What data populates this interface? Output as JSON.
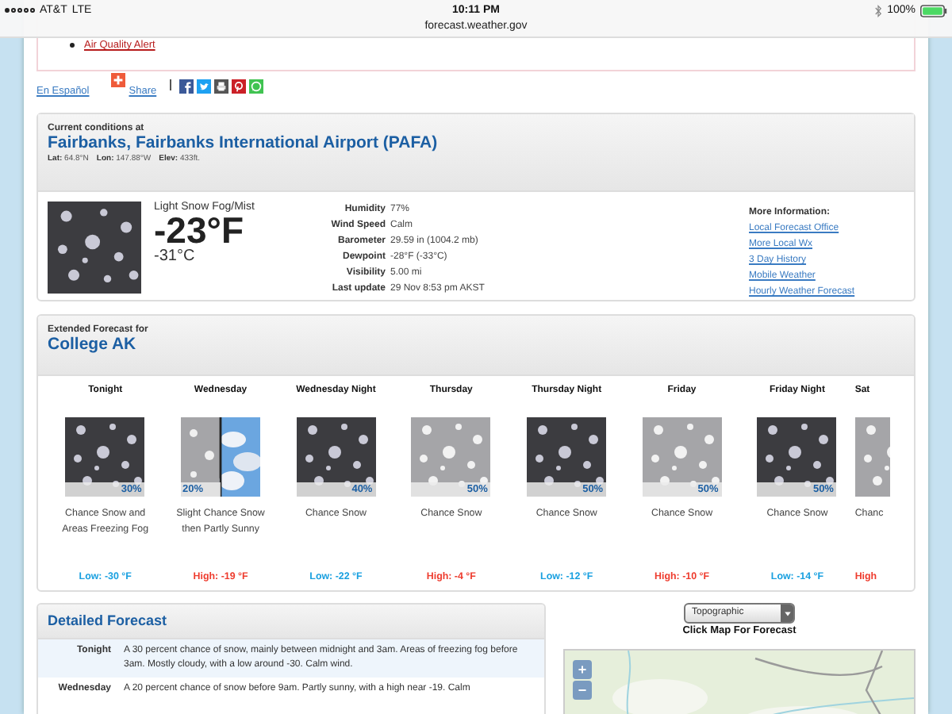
{
  "status_bar": {
    "carrier": "AT&T",
    "network": "LTE",
    "time": "10:11 PM",
    "url": "forecast.weather.gov",
    "battery": "100%"
  },
  "hazards": {
    "items": [
      "Air Quality Alert"
    ]
  },
  "share": {
    "language_link": "En Español",
    "share_label": "Share"
  },
  "current": {
    "heading": "Current conditions at",
    "station": "Fairbanks, Fairbanks International Airport (PAFA)",
    "coords": [
      {
        "label": "Lat:",
        "value": "64.8°N"
      },
      {
        "label": "Lon:",
        "value": "147.88°W"
      },
      {
        "label": "Elev:",
        "value": "433ft."
      }
    ],
    "condition": "Light Snow Fog/Mist",
    "temp_f": "-23°F",
    "temp_c": "-31°C",
    "details": [
      {
        "label": "Humidity",
        "value": "77%"
      },
      {
        "label": "Wind Speed",
        "value": "Calm"
      },
      {
        "label": "Barometer",
        "value": "29.59 in (1004.2 mb)"
      },
      {
        "label": "Dewpoint",
        "value": "-28°F (-33°C)"
      },
      {
        "label": "Visibility",
        "value": "5.00 mi"
      },
      {
        "label": "Last update",
        "value": "29 Nov 8:53 pm AKST"
      }
    ],
    "more_info": {
      "heading": "More Information:",
      "links": [
        "Local Forecast Office",
        "More Local Wx",
        "3 Day History",
        "Mobile Weather",
        "Hourly Weather Forecast"
      ]
    }
  },
  "extended": {
    "heading": "Extended Forecast for",
    "place": "College AK",
    "periods": [
      {
        "name": "Tonight",
        "image": {
          "kind": "dark"
        },
        "chance": "30%",
        "summary": "Chance Snow and Areas Freezing Fog",
        "temp": {
          "kind": "low",
          "text": "Low: -30 °F"
        }
      },
      {
        "name": "Wednesday",
        "image": {
          "kind": "split"
        },
        "chance": "20%",
        "summary": "Slight Chance Snow then Partly Sunny",
        "temp": {
          "kind": "high",
          "text": "High: -19 °F"
        }
      },
      {
        "name": "Wednesday Night",
        "image": {
          "kind": "dark"
        },
        "chance": "40%",
        "summary": "Chance Snow",
        "temp": {
          "kind": "low",
          "text": "Low: -22 °F"
        }
      },
      {
        "name": "Thursday",
        "image": {
          "kind": "light"
        },
        "chance": "50%",
        "summary": "Chance Snow",
        "temp": {
          "kind": "high",
          "text": "High: -4 °F"
        }
      },
      {
        "name": "Thursday Night",
        "image": {
          "kind": "dark"
        },
        "chance": "50%",
        "summary": "Chance Snow",
        "temp": {
          "kind": "low",
          "text": "Low: -12 °F"
        }
      },
      {
        "name": "Friday",
        "image": {
          "kind": "light"
        },
        "chance": "50%",
        "summary": "Chance Snow",
        "temp": {
          "kind": "high",
          "text": "High: -10 °F"
        }
      },
      {
        "name": "Friday Night",
        "image": {
          "kind": "dark"
        },
        "chance": "50%",
        "summary": "Chance Snow",
        "temp": {
          "kind": "low",
          "text": "Low: -14 °F"
        }
      },
      {
        "name": "Sat",
        "image": {
          "kind": "light"
        },
        "summary": "Chanc",
        "temp": {
          "kind": "high",
          "text": "High"
        }
      }
    ]
  },
  "detailed": {
    "heading": "Detailed Forecast",
    "rows": [
      {
        "period": "Tonight",
        "text": "A 30 percent chance of snow, mainly between midnight and 3am. Areas of freezing fog before 3am. Mostly cloudy, with a low around -30. Calm wind."
      },
      {
        "period": "Wednesday",
        "text": "A 20 percent chance of snow before 9am. Partly sunny, with a high near -19. Calm"
      }
    ]
  },
  "map": {
    "layer": "Topographic",
    "hint": "Click Map For Forecast",
    "zoom_in": "+",
    "zoom_out": "−"
  }
}
